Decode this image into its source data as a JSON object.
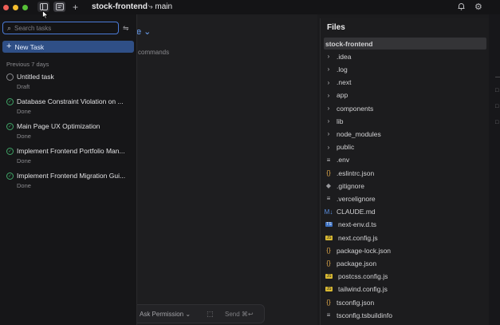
{
  "window": {
    "traffic_colors": [
      "#ee5f57",
      "#f5be2f",
      "#57c038"
    ],
    "repo": "stock-frontend",
    "branch_icon": "git-branch-icon",
    "branch": "main"
  },
  "chat": {
    "title_fragment": "e",
    "subtitle_fragment": "commands",
    "permission_label": "Ask Permission",
    "send_label": "Send ⌘↩"
  },
  "tasks_panel": {
    "search_placeholder": "Search tasks",
    "new_task_label": "New Task",
    "section_label": "Previous 7 days",
    "tasks": [
      {
        "name": "Untitled task",
        "status": "Draft"
      },
      {
        "name": "Database Constraint Violation on ...",
        "status": "Done"
      },
      {
        "name": "Main Page UX Optimization",
        "status": "Done"
      },
      {
        "name": "Implement Frontend Portfolio Man...",
        "status": "Done"
      },
      {
        "name": "Implement Frontend Migration Gui...",
        "status": "Done"
      }
    ]
  },
  "files_panel": {
    "title": "Files",
    "items": [
      {
        "name": "stock-frontend",
        "icon": "",
        "kind": "root"
      },
      {
        "name": ".idea",
        "icon": "›",
        "kind": "folder"
      },
      {
        "name": ".log",
        "icon": "›",
        "kind": "folder"
      },
      {
        "name": ".next",
        "icon": "›",
        "kind": "folder"
      },
      {
        "name": "app",
        "icon": "›",
        "kind": "folder"
      },
      {
        "name": "components",
        "icon": "›",
        "kind": "folder"
      },
      {
        "name": "lib",
        "icon": "›",
        "kind": "folder"
      },
      {
        "name": "node_modules",
        "icon": "›",
        "kind": "folder"
      },
      {
        "name": "public",
        "icon": "›",
        "kind": "folder"
      },
      {
        "name": ".env",
        "icon": "≡",
        "kind": "file"
      },
      {
        "name": ".eslintrc.json",
        "icon": "{}",
        "kind": "json"
      },
      {
        "name": ".gitignore",
        "icon": "◆",
        "kind": "git"
      },
      {
        "name": ".vercelignore",
        "icon": "≡",
        "kind": "file"
      },
      {
        "name": "CLAUDE.md",
        "icon": "M↓",
        "kind": "md"
      },
      {
        "name": "next-env.d.ts",
        "icon": "TS",
        "kind": "ts"
      },
      {
        "name": "next.config.js",
        "icon": "JS",
        "kind": "js"
      },
      {
        "name": "package-lock.json",
        "icon": "{}",
        "kind": "json"
      },
      {
        "name": "package.json",
        "icon": "{}",
        "kind": "json"
      },
      {
        "name": "postcss.config.js",
        "icon": "JS",
        "kind": "js"
      },
      {
        "name": "tailwind.config.js",
        "icon": "JS",
        "kind": "js"
      },
      {
        "name": "tsconfig.json",
        "icon": "{}",
        "kind": "json"
      },
      {
        "name": "tsconfig.tsbuildinfo",
        "icon": "≡",
        "kind": "file"
      }
    ]
  }
}
